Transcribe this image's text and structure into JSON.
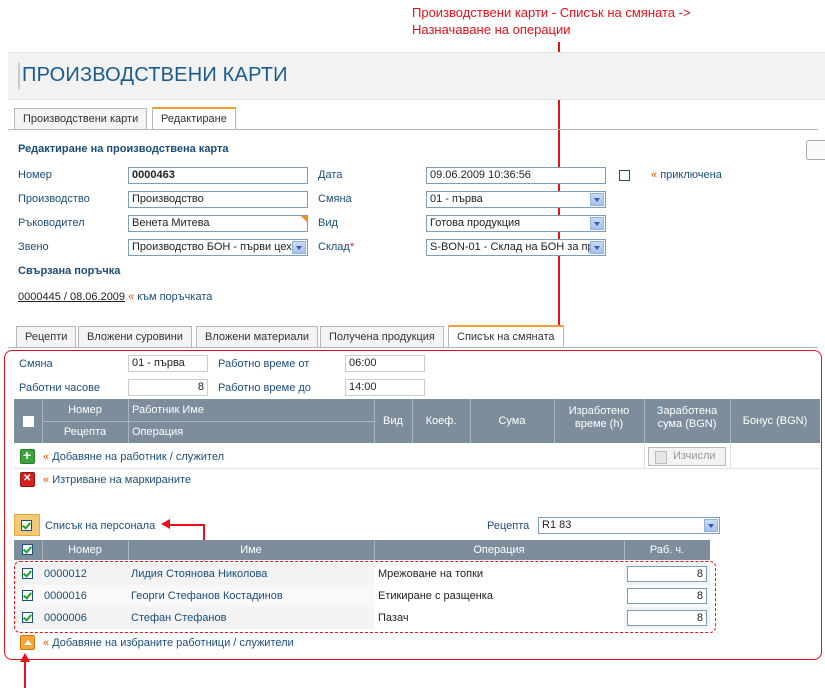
{
  "annotation_top": "Производствени карти - Списък на смяната -> Назначаване на операции",
  "page_title": "ПРОИЗВОДСТВЕНИ КАРТИ",
  "main_tabs": [
    "Производствени карти",
    "Редактиране"
  ],
  "edit_section_title": "Редактиране на производствена карта",
  "form": {
    "nomer_label": "Номер",
    "nomer_value": "0000463",
    "data_label": "Дата",
    "data_value": "09.06.2009 10:36:56",
    "prikluchena_label": "приключена",
    "proizvodstvo_label": "Производство",
    "proizvodstvo_value": "Производство",
    "smyana_label": "Смяна",
    "smyana_value": "01 - първа",
    "rakovoditel_label": "Ръководител",
    "rakovoditel_value": "Венета Митева",
    "vid_label": "Вид",
    "vid_value": "Готова продукция",
    "zveno_label": "Звено",
    "zveno_value": "Производство БОН - първи цех",
    "sklad_label": "Склад",
    "sklad_required": "*",
    "sklad_value": "S-BON-01 - Склад на БОН за пр"
  },
  "linked_order": {
    "title": "Свързана поръчка",
    "link": "0000445 / 08.06.2009",
    "to_order": "към поръчката"
  },
  "sub_tabs": [
    "Рецепти",
    "Вложени суровини",
    "Вложени материали",
    "Получена продукция",
    "Списък на смяната"
  ],
  "shift": {
    "smyana_label": "Смяна",
    "smyana_value": "01 - първа",
    "work_from_label": "Работно време от",
    "work_from_value": "06:00",
    "hours_label": "Работни часове",
    "hours_value": "8",
    "work_to_label": "Работно време до",
    "work_to_value": "14:00"
  },
  "workers_grid": {
    "h_nomer": "Номер",
    "h_worker": "Работник Име",
    "h_recepta": "Рецепта",
    "h_operation": "Операция",
    "h_vid": "Вид",
    "h_koef": "Коеф.",
    "h_suma": "Сума",
    "h_time": "Изработено време (h)",
    "h_earned": "Заработена сума (BGN)",
    "h_bonus": "Бонус (BGN)",
    "add_label": "Добавяне на работник / служител",
    "calc_label": "Изчисли",
    "delete_label": "Изтриване на маркираните"
  },
  "personnel": {
    "title": "Списък на персонала",
    "recepta_label": "Рецепта",
    "recepta_value": "R1 83",
    "h_nomer": "Номер",
    "h_name": "Име",
    "h_operation": "Операция",
    "h_hours": "Раб. ч.",
    "rows": [
      {
        "nomer": "0000012",
        "name": "Лидия Стоянова Николова",
        "operation": "Мрежоване на топки",
        "hours": "8"
      },
      {
        "nomer": "0000016",
        "name": "Георги Стефанов Костадинов",
        "operation": "Етикиране с разщенка",
        "hours": "8"
      },
      {
        "nomer": "0000006",
        "name": "Стефан Стефанов",
        "operation": "Пазач",
        "hours": "8"
      }
    ],
    "add_selected_label": "Добавяне на избраните работници / служители"
  },
  "colors": {
    "accent_red": "#e8101a",
    "title_blue": "#1a5b8f",
    "grid_header": "#7d8d9b"
  }
}
